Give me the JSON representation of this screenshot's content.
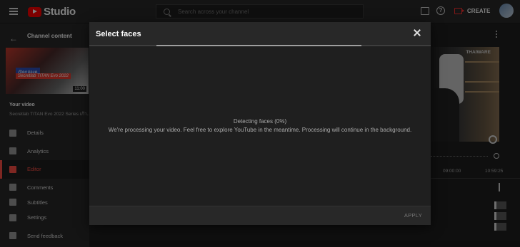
{
  "topbar": {
    "logo_text": "Studio",
    "search_placeholder": "Search across your channel",
    "create_label": "CREATE"
  },
  "sidebar": {
    "title": "Channel content",
    "thumbnail": {
      "badge": "เปิดกล่องดู",
      "subtitle": "Secretlab TITAN Evo 2022",
      "duration": "11:00"
    },
    "your_video_label": "Your video",
    "video_name": "Secretlab TITAN Evo 2022 Series เก้า...",
    "items": [
      {
        "label": "Details",
        "icon": "pencil-icon",
        "active": false
      },
      {
        "label": "Analytics",
        "icon": "analytics-icon",
        "active": false
      },
      {
        "label": "Editor",
        "icon": "editor-icon",
        "active": true
      },
      {
        "label": "Comments",
        "icon": "comments-icon",
        "active": false
      },
      {
        "label": "Subtitles",
        "icon": "subtitles-icon",
        "active": false
      }
    ],
    "bottom_items": [
      {
        "label": "Settings",
        "icon": "gear-icon"
      },
      {
        "label": "Send feedback",
        "icon": "feedback-icon"
      }
    ]
  },
  "preview": {
    "watermark": "THAIWARE",
    "time_marks": [
      "09:00:00",
      "10:59:25"
    ]
  },
  "modal": {
    "title": "Select faces",
    "progress": 0.65,
    "status_title": "Detecting faces (0%)",
    "status_desc": "We're processing your video. Feel free to explore YouTube in the meantime. Processing will continue in the background.",
    "apply_label": "APPLY"
  },
  "colors": {
    "accent": "#ff4e45",
    "brand": "#ff0000"
  }
}
